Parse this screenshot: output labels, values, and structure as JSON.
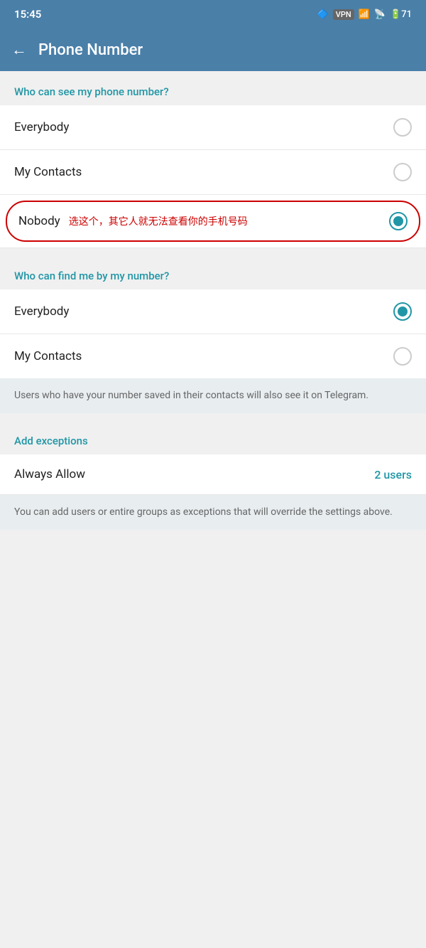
{
  "statusBar": {
    "time": "15:45",
    "bluetooth": "🔷",
    "vpn": "VPN",
    "signal": "📶",
    "wifi": "📡",
    "battery": "71"
  },
  "appBar": {
    "title": "Phone Number",
    "backLabel": "←"
  },
  "section1": {
    "header": "Who can see my phone number?",
    "options": [
      {
        "label": "Everybody",
        "selected": false
      },
      {
        "label": "My Contacts",
        "selected": false
      },
      {
        "label": "Nobody",
        "selected": true,
        "annotation": "选这个，其它人就无法查看你的手机号码"
      }
    ]
  },
  "section2": {
    "header": "Who can find me by my number?",
    "options": [
      {
        "label": "Everybody",
        "selected": true
      },
      {
        "label": "My Contacts",
        "selected": false
      }
    ],
    "infoText": "Users who have your number saved in their contacts will also see it on Telegram."
  },
  "exceptions": {
    "header": "Add exceptions",
    "rows": [
      {
        "label": "Always Allow",
        "value": "2 users"
      }
    ],
    "infoText": "You can add users or entire groups as exceptions that will override the settings above."
  }
}
